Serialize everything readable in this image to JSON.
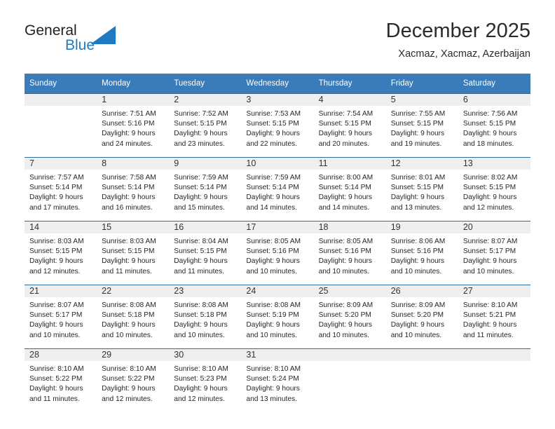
{
  "brand": {
    "word_one": "General",
    "word_two": "Blue",
    "logo_icon": "triangle-logo-icon",
    "colors": {
      "text": "#231f20",
      "accent": "#1f7bc1"
    }
  },
  "header": {
    "title": "December 2025",
    "subtitle": "Xacmaz, Xacmaz, Azerbaijan"
  },
  "theme": {
    "header_bg": "#3a7cb9",
    "row_rule": "#2e6da4",
    "daynum_band": "#efefef",
    "page_bg": "#ffffff"
  },
  "calendar": {
    "weekday_headers": [
      "Sunday",
      "Monday",
      "Tuesday",
      "Wednesday",
      "Thursday",
      "Friday",
      "Saturday"
    ],
    "weeks": [
      [
        {
          "day": "",
          "lines": []
        },
        {
          "day": "1",
          "lines": [
            "Sunrise: 7:51 AM",
            "Sunset: 5:16 PM",
            "Daylight: 9 hours",
            "and 24 minutes."
          ]
        },
        {
          "day": "2",
          "lines": [
            "Sunrise: 7:52 AM",
            "Sunset: 5:15 PM",
            "Daylight: 9 hours",
            "and 23 minutes."
          ]
        },
        {
          "day": "3",
          "lines": [
            "Sunrise: 7:53 AM",
            "Sunset: 5:15 PM",
            "Daylight: 9 hours",
            "and 22 minutes."
          ]
        },
        {
          "day": "4",
          "lines": [
            "Sunrise: 7:54 AM",
            "Sunset: 5:15 PM",
            "Daylight: 9 hours",
            "and 20 minutes."
          ]
        },
        {
          "day": "5",
          "lines": [
            "Sunrise: 7:55 AM",
            "Sunset: 5:15 PM",
            "Daylight: 9 hours",
            "and 19 minutes."
          ]
        },
        {
          "day": "6",
          "lines": [
            "Sunrise: 7:56 AM",
            "Sunset: 5:15 PM",
            "Daylight: 9 hours",
            "and 18 minutes."
          ]
        }
      ],
      [
        {
          "day": "7",
          "lines": [
            "Sunrise: 7:57 AM",
            "Sunset: 5:14 PM",
            "Daylight: 9 hours",
            "and 17 minutes."
          ]
        },
        {
          "day": "8",
          "lines": [
            "Sunrise: 7:58 AM",
            "Sunset: 5:14 PM",
            "Daylight: 9 hours",
            "and 16 minutes."
          ]
        },
        {
          "day": "9",
          "lines": [
            "Sunrise: 7:59 AM",
            "Sunset: 5:14 PM",
            "Daylight: 9 hours",
            "and 15 minutes."
          ]
        },
        {
          "day": "10",
          "lines": [
            "Sunrise: 7:59 AM",
            "Sunset: 5:14 PM",
            "Daylight: 9 hours",
            "and 14 minutes."
          ]
        },
        {
          "day": "11",
          "lines": [
            "Sunrise: 8:00 AM",
            "Sunset: 5:14 PM",
            "Daylight: 9 hours",
            "and 14 minutes."
          ]
        },
        {
          "day": "12",
          "lines": [
            "Sunrise: 8:01 AM",
            "Sunset: 5:15 PM",
            "Daylight: 9 hours",
            "and 13 minutes."
          ]
        },
        {
          "day": "13",
          "lines": [
            "Sunrise: 8:02 AM",
            "Sunset: 5:15 PM",
            "Daylight: 9 hours",
            "and 12 minutes."
          ]
        }
      ],
      [
        {
          "day": "14",
          "lines": [
            "Sunrise: 8:03 AM",
            "Sunset: 5:15 PM",
            "Daylight: 9 hours",
            "and 12 minutes."
          ]
        },
        {
          "day": "15",
          "lines": [
            "Sunrise: 8:03 AM",
            "Sunset: 5:15 PM",
            "Daylight: 9 hours",
            "and 11 minutes."
          ]
        },
        {
          "day": "16",
          "lines": [
            "Sunrise: 8:04 AM",
            "Sunset: 5:15 PM",
            "Daylight: 9 hours",
            "and 11 minutes."
          ]
        },
        {
          "day": "17",
          "lines": [
            "Sunrise: 8:05 AM",
            "Sunset: 5:16 PM",
            "Daylight: 9 hours",
            "and 10 minutes."
          ]
        },
        {
          "day": "18",
          "lines": [
            "Sunrise: 8:05 AM",
            "Sunset: 5:16 PM",
            "Daylight: 9 hours",
            "and 10 minutes."
          ]
        },
        {
          "day": "19",
          "lines": [
            "Sunrise: 8:06 AM",
            "Sunset: 5:16 PM",
            "Daylight: 9 hours",
            "and 10 minutes."
          ]
        },
        {
          "day": "20",
          "lines": [
            "Sunrise: 8:07 AM",
            "Sunset: 5:17 PM",
            "Daylight: 9 hours",
            "and 10 minutes."
          ]
        }
      ],
      [
        {
          "day": "21",
          "lines": [
            "Sunrise: 8:07 AM",
            "Sunset: 5:17 PM",
            "Daylight: 9 hours",
            "and 10 minutes."
          ]
        },
        {
          "day": "22",
          "lines": [
            "Sunrise: 8:08 AM",
            "Sunset: 5:18 PM",
            "Daylight: 9 hours",
            "and 10 minutes."
          ]
        },
        {
          "day": "23",
          "lines": [
            "Sunrise: 8:08 AM",
            "Sunset: 5:18 PM",
            "Daylight: 9 hours",
            "and 10 minutes."
          ]
        },
        {
          "day": "24",
          "lines": [
            "Sunrise: 8:08 AM",
            "Sunset: 5:19 PM",
            "Daylight: 9 hours",
            "and 10 minutes."
          ]
        },
        {
          "day": "25",
          "lines": [
            "Sunrise: 8:09 AM",
            "Sunset: 5:20 PM",
            "Daylight: 9 hours",
            "and 10 minutes."
          ]
        },
        {
          "day": "26",
          "lines": [
            "Sunrise: 8:09 AM",
            "Sunset: 5:20 PM",
            "Daylight: 9 hours",
            "and 10 minutes."
          ]
        },
        {
          "day": "27",
          "lines": [
            "Sunrise: 8:10 AM",
            "Sunset: 5:21 PM",
            "Daylight: 9 hours",
            "and 11 minutes."
          ]
        }
      ],
      [
        {
          "day": "28",
          "lines": [
            "Sunrise: 8:10 AM",
            "Sunset: 5:22 PM",
            "Daylight: 9 hours",
            "and 11 minutes."
          ]
        },
        {
          "day": "29",
          "lines": [
            "Sunrise: 8:10 AM",
            "Sunset: 5:22 PM",
            "Daylight: 9 hours",
            "and 12 minutes."
          ]
        },
        {
          "day": "30",
          "lines": [
            "Sunrise: 8:10 AM",
            "Sunset: 5:23 PM",
            "Daylight: 9 hours",
            "and 12 minutes."
          ]
        },
        {
          "day": "31",
          "lines": [
            "Sunrise: 8:10 AM",
            "Sunset: 5:24 PM",
            "Daylight: 9 hours",
            "and 13 minutes."
          ]
        },
        {
          "day": "",
          "lines": []
        },
        {
          "day": "",
          "lines": []
        },
        {
          "day": "",
          "lines": []
        }
      ]
    ]
  }
}
